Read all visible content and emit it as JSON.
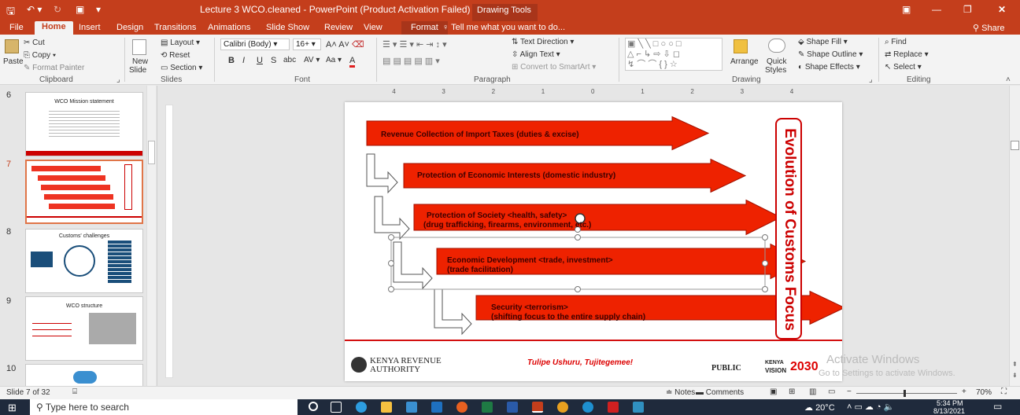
{
  "titlebar": {
    "title": "Lecture 3  WCO.cleaned - PowerPoint (Product Activation Failed)",
    "drawing_tools": "Drawing Tools"
  },
  "tabs": [
    "File",
    "Home",
    "Insert",
    "Design",
    "Transitions",
    "Animations",
    "Slide Show",
    "Review",
    "View",
    "Format"
  ],
  "tell_me": "Tell me what you want to do...",
  "share": "Share",
  "ribbon": {
    "clipboard": {
      "cut": "Cut",
      "copy": "Copy",
      "format_painter": "Format Painter",
      "paste": "Paste",
      "group": "Clipboard"
    },
    "slides": {
      "new_slide": "New",
      "new_slide2": "Slide",
      "layout": "Layout",
      "reset": "Reset",
      "section": "Section",
      "group": "Slides"
    },
    "font": {
      "family": "Calibri (Body)",
      "size": "16+",
      "group": "Font"
    },
    "paragraph": {
      "text_direction": "Text Direction",
      "align_text": "Align Text",
      "convert_smartart": "Convert to SmartArt",
      "group": "Paragraph"
    },
    "drawing": {
      "arrange": "Arrange",
      "quick_styles": "Quick",
      "quick_styles2": "Styles",
      "shape_fill": "Shape Fill",
      "shape_outline": "Shape Outline",
      "shape_effects": "Shape Effects",
      "group": "Drawing"
    },
    "editing": {
      "find": "Find",
      "replace": "Replace",
      "select": "Select",
      "group": "Editing"
    }
  },
  "thumbnails": [
    {
      "num": "6",
      "title": "WCO Mission statement"
    },
    {
      "num": "7",
      "title": ""
    },
    {
      "num": "8",
      "title": "Customs' challenges"
    },
    {
      "num": "9",
      "title": "WCO structure"
    },
    {
      "num": "10",
      "title": ""
    }
  ],
  "slide": {
    "vertical_title": "Evolution of Customs Focus",
    "arrows": [
      {
        "line1": "Revenue Collection of Import Taxes (duties & excise)",
        "line2": ""
      },
      {
        "line1": "Protection of Economic Interests (domestic industry)",
        "line2": ""
      },
      {
        "line1": "Protection of Society <health, safety>",
        "line2": "(drug trafficking, firearms, environment, etc.)"
      },
      {
        "line1": "Economic Development <trade, investment>",
        "line2": "(trade facilitation)"
      },
      {
        "line1": "Security <terrorism>",
        "line2": "(shifting focus to the entire supply chain)"
      }
    ],
    "footer": {
      "kra1": "KENYA REVENUE",
      "kra2": "AUTHORITY",
      "slogan": "Tulipe Ushuru, Tujitegemee!",
      "public": "PUBLIC",
      "kenya": "KENYA",
      "vision": "VISION",
      "year": "2030"
    }
  },
  "watermark": {
    "line1": "Activate Windows",
    "line2": "Go to Settings to activate Windows."
  },
  "ruler_labels": [
    "4",
    "3",
    "2",
    "1",
    "0",
    "1",
    "2",
    "3",
    "4"
  ],
  "status": {
    "slide": "Slide 7 of 32",
    "notes": "Notes",
    "comments": "Comments",
    "zoom": "70%"
  },
  "taskbar": {
    "search": "Type here to search",
    "weather": "20°C",
    "time": "5:34 PM",
    "date": "8/13/2021"
  },
  "colors": {
    "accent": "#c43e1c",
    "arrow": "#ee2200",
    "arrow_border": "#a01000"
  }
}
